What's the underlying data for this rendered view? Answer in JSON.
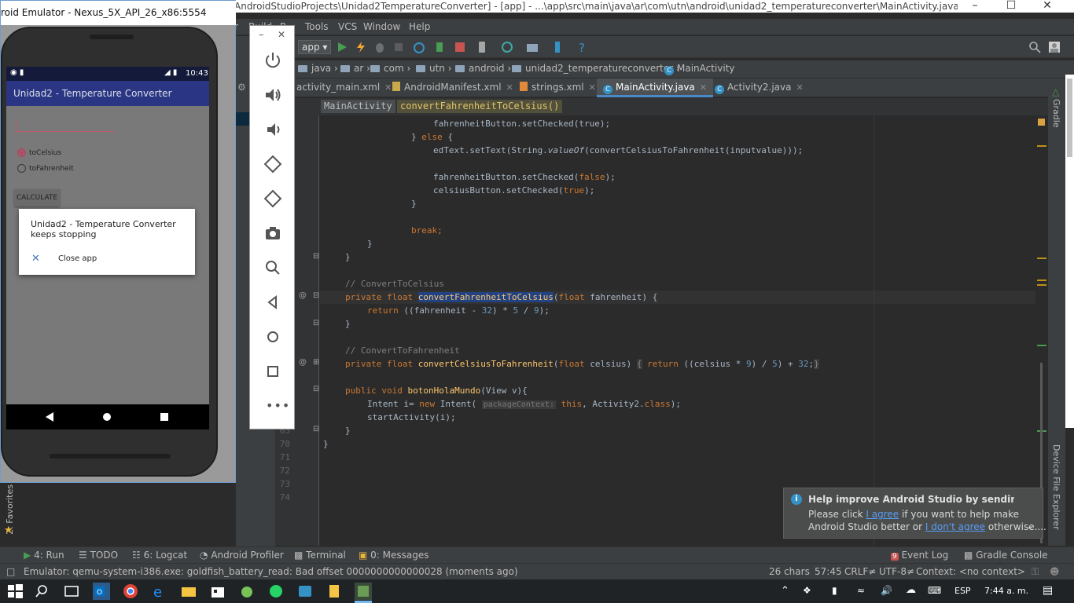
{
  "android_studio": {
    "title": "AndroidStudioProjects\\Unidad2TemperatureConverter] - [app] - ...\\app\\src\\main\\java\\ar\\com\\utn\\android\\unidad2_temperatureconverter\\MainActivity.java - Android Stu...",
    "menu": [
      "r",
      "Build",
      "R",
      "Tools",
      "VCS",
      "Window",
      "Help"
    ],
    "run_config": "app",
    "breadcrumbs": [
      "java",
      "ar",
      "com",
      "utn",
      "android",
      "unidad2_temperatureconverter",
      "MainActivity"
    ],
    "tabs": [
      {
        "label": "activity_main.xml"
      },
      {
        "label": "AndroidManifest.xml"
      },
      {
        "label": "strings.xml"
      },
      {
        "label": "MainActivity.java",
        "active": true
      },
      {
        "label": "Activity2.java"
      }
    ],
    "structure_crumbs": [
      "MainActivity",
      "convertFahrenheitToCelsius()"
    ],
    "line_numbers": [
      "65",
      "70",
      "71",
      "72",
      "73",
      "74"
    ],
    "code": {
      "l1": "fahrenheitButton.setChecked(true);",
      "l2a": "} ",
      "l2b": "else",
      "l2c": " {",
      "l3a": "edText.setText(String.",
      "l3b": "valueOf",
      "l3c": "(convertCelsiusToFahrenheit(inputvalue)));",
      "l4a": "fahrenheitButton.setChecked(",
      "l4b": "false",
      "l4c": ");",
      "l5a": "celsiusButton.setChecked(",
      "l5b": "true",
      "l5c": ");",
      "l6": "}",
      "l7": "break;",
      "l8": "}",
      "l9": "}",
      "l10": "// ConvertToCelsius",
      "l11a": "private float ",
      "l11b": "convertFahrenheitToCelsius",
      "l11c": "(",
      "l11d": "float",
      "l11e": " fahrenheit) {",
      "l12a": "return ",
      "l12b": "((fahrenheit - ",
      "l12c": "32",
      "l12d": ") * ",
      "l12e": "5",
      "l12f": " / ",
      "l12g": "9",
      "l12h": ");",
      "l13": "}",
      "l14": "// ConvertToFahrenheit",
      "l15a": "private float ",
      "l15b": "convertCelsiusToFahrenheit",
      "l15c": "(",
      "l15d": "float",
      "l15e": " celsius) ",
      "l15f": "{",
      "l15g": "return",
      "l15h": " ((celsius * ",
      "l15i": "9",
      "l15j": ") / ",
      "l15k": "5",
      "l15l": ") + ",
      "l15m": "32",
      "l15n": ";",
      "l15o": "}",
      "l16a": "public void ",
      "l16b": "botonHolaMundo",
      "l16c": "(View v){",
      "l17a": "Intent i= ",
      "l17b": "new",
      "l17c": " Intent( ",
      "l17d": "packageContext:",
      "l17e": " this",
      "l17f": ", Activity2.",
      "l17g": "class",
      "l17h": ");",
      "l18": "startActivity(i);",
      "l19": "}",
      "l20": "}"
    },
    "right_tools": [
      "Gradle",
      "Device File Explorer"
    ],
    "left_tools": [
      "2: Favorites"
    ],
    "bottom_tools": [
      "4: Run",
      "TODO",
      "6: Logcat",
      "Android Profiler",
      "Terminal",
      "0: Messages",
      "Event Log",
      "Gradle Console"
    ],
    "event_log_badge": "9",
    "status": {
      "message": "Emulator: qemu-system-i386.exe: goldfish_battery_read: Bad offset 0000000000000028 (moments ago)",
      "chars": "26 chars",
      "position": "57:45",
      "line_sep": "CRLF≠",
      "encoding": "UTF-8≠",
      "context": "Context: <no context>"
    },
    "notification": {
      "title": "Help improve Android Studio by sending usage st",
      "line1_pre": "Please click ",
      "agree": "I agree",
      "line1_post": " if you want to help make",
      "line2_pre": "Android Studio better or ",
      "disagree": "I don't agree",
      "line2_post": " otherwise...."
    }
  },
  "emulator": {
    "title": "roid Emulator - Nexus_5X_API_26_x86:5554",
    "time": "10:43",
    "app_title": "Unidad2 - Temperature Converter",
    "radio1": "toCelsius",
    "radio2": "toFahrenheit",
    "calc_button": "CALCULATE",
    "dialog_title": "Unidad2 - Temperature Converter keeps stopping",
    "dialog_action": "Close app",
    "side_icons": [
      "power-icon",
      "volume-up-icon",
      "volume-down-icon",
      "rotate-left-icon",
      "rotate-right-icon",
      "camera-icon",
      "zoom-icon",
      "back-icon",
      "home-icon",
      "overview-icon",
      "more-icon"
    ]
  },
  "taskbar": {
    "language": "ESP",
    "time": "7:44 a. m."
  },
  "colors": {
    "editor_bg": "#2b2b2b",
    "keyword": "#cc7832",
    "number": "#6897bb",
    "comment": "#808080",
    "method": "#ffc66d",
    "selection": "#214283",
    "app_bar": "#2a3683",
    "accent": "#e91e63"
  }
}
